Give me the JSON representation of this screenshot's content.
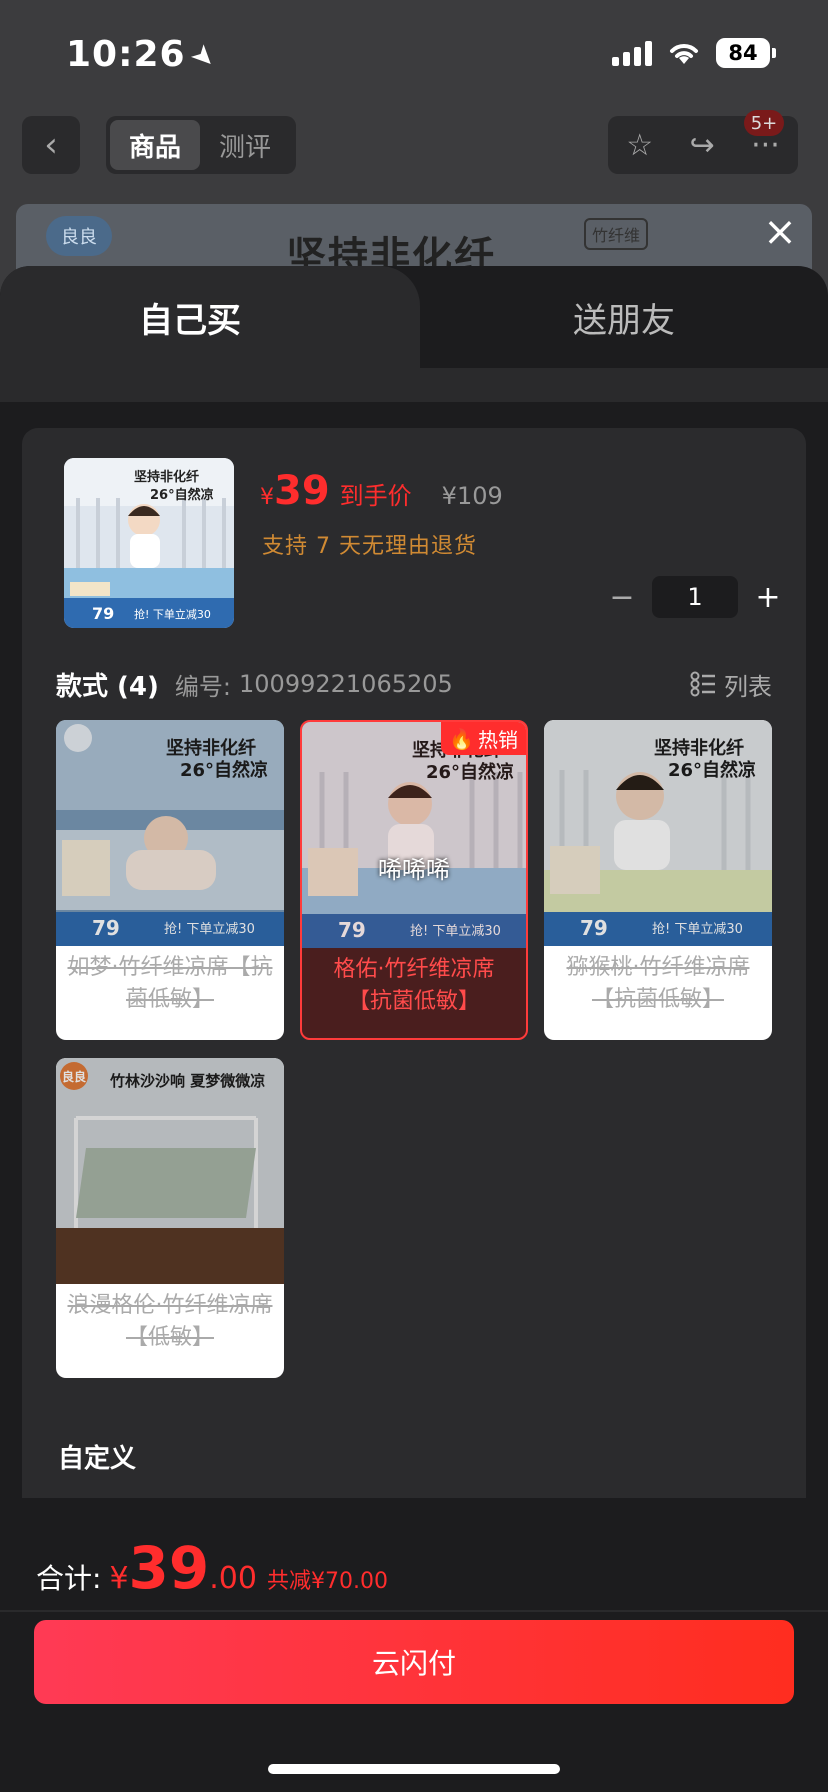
{
  "status_bar": {
    "time": "10:26",
    "battery": "84"
  },
  "nav": {
    "tabs": [
      "商品",
      "测评"
    ],
    "active_tab": "商品",
    "badge": "5+"
  },
  "banner": {
    "logo": "良良",
    "headline": "坚持非化纤",
    "tag": "竹纤维"
  },
  "sheet": {
    "tabs": {
      "self": "自己买",
      "friend": "送朋友"
    },
    "product": {
      "thumb_headline": "坚持非化纤",
      "thumb_sub": "26°自然凉",
      "thumb_price": "79",
      "thumb_promo": "抢! 下单立减30",
      "price_currency": "¥",
      "price": "39",
      "price_label": "到手价",
      "original_price": "¥109",
      "return_note": "支持 7 天无理由退货"
    },
    "quantity": {
      "minus": "−",
      "value": "1",
      "plus": "+"
    },
    "specs": {
      "title": "款式 (4)",
      "code_label": "编号:",
      "code": "10099221065205",
      "list_toggle": "列表",
      "options": [
        {
          "label": "如梦·竹纤维凉席【抗菌低敏】",
          "img_headline": "坚持非化纤",
          "img_sub": "26°自然凉",
          "price": "79",
          "promo": "抢! 下单立减30"
        },
        {
          "label": "格佑·竹纤维凉席【抗菌低敏】",
          "img_headline": "坚持非化纤",
          "img_sub": "26°自然凉",
          "price": "79",
          "promo": "抢! 下单立减30",
          "hot": "热销",
          "overlay": "唏唏唏"
        },
        {
          "label": "猕猴桃·竹纤维凉席【抗菌低敏】",
          "img_headline": "坚持非化纤",
          "img_sub": "26°自然凉",
          "price": "79",
          "promo": "抢! 下单立减30"
        },
        {
          "label": "浪漫格伦·竹纤维凉席【低敏】",
          "img_headline": "竹林沙沙响 夏梦微微凉",
          "logo": "良良"
        }
      ]
    },
    "custom_title": "自定义"
  },
  "footer": {
    "total_label": "合计:",
    "currency": "¥",
    "total_int": "39",
    "total_dec": ".00",
    "savings": "共减¥70.00",
    "pay_button": "云闪付"
  },
  "colors": {
    "accent": "#ff2d2d",
    "return_note": "#d08a33",
    "sheet_bg": "#1c1c1e",
    "card_bg": "#2b2b2d"
  }
}
